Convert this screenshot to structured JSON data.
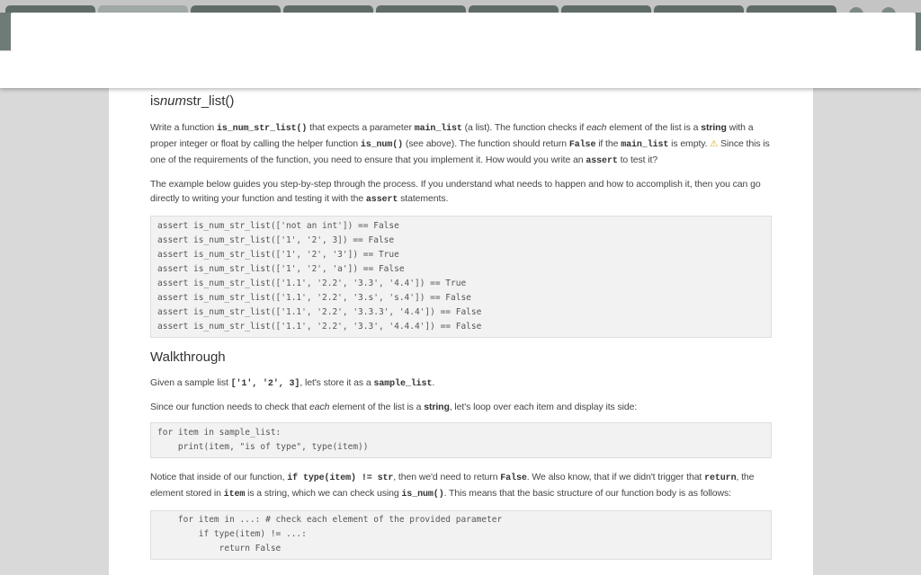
{
  "section": {
    "title_pre": "is",
    "title_em": "num",
    "title_post": "str_list()"
  },
  "intro": {
    "t1": "Write a function ",
    "c1": "is_num_str_list()",
    "t2": " that expects a parameter ",
    "c2": "main_list",
    "t3": " (a list). The function checks if ",
    "e1": "each",
    "t4": " element of the list is a ",
    "b1": "string",
    "t5": " with a proper integer or float by calling the helper function ",
    "c3": "is_num()",
    "t6": " (see above). The function should return ",
    "c4": "False",
    "t7": " if the ",
    "c5": "main_list",
    "t8": " is empty. ",
    "warn": "⚠",
    "t9": " Since this is one of the requirements of the function, you need to ensure that you implement it. How would you write an ",
    "c6": "assert",
    "t10": " to test it?"
  },
  "example": {
    "t1": "The example below guides you step-by-step through the process. If you understand what needs to happen and how to accomplish it, then you can go directly to writing your function and testing it with the ",
    "c1": "assert",
    "t2": " statements."
  },
  "asserts": [
    "assert is_num_str_list(['not an int']) == False",
    "assert is_num_str_list(['1', '2', 3]) == False",
    "assert is_num_str_list(['1', '2', '3']) == True",
    "assert is_num_str_list(['1', '2', 'a']) == False",
    "assert is_num_str_list(['1.1', '2.2', '3.3', '4.4']) == True",
    "assert is_num_str_list(['1.1', '2.2', '3.s', 's.4']) == False",
    "assert is_num_str_list(['1.1', '2.2', '3.3.3', '4.4']) == False",
    "assert is_num_str_list(['1.1', '2.2', '3.3', '4.4.4']) == False"
  ],
  "walkthrough": {
    "title": "Walkthrough",
    "p1_t1": "Given a sample list ",
    "p1_c1": "['1', '2', 3]",
    "p1_t2": ", let's store it as a ",
    "p1_c2": "sample_list",
    "p1_t3": ".",
    "p2_t1": "Since our function needs to check that ",
    "p2_e1": "each",
    "p2_t2": " element of the list is a ",
    "p2_b1": "string",
    "p2_t3": ", let's loop over each item and display its side:",
    "code1": [
      "for item in sample_list:",
      "    print(item, \"is of type\", type(item))"
    ],
    "p3_t1": "Notice that inside of our function, ",
    "p3_c1": "if type(item) != str",
    "p3_t2": ", then we'd need to return ",
    "p3_c2": "False",
    "p3_t3": ". We also know, that if we didn't trigger that ",
    "p3_c3": "return",
    "p3_t4": ", the element stored in ",
    "p3_c4": "item",
    "p3_t5": " is a string, which we can check using ",
    "p3_c5": "is_num()",
    "p3_t6": ". This means that the basic structure of our function body is as follows:",
    "code2": [
      "    for item in ...: # check each element of the provided parameter",
      "        if type(item) != ...:",
      "            return False"
    ]
  }
}
